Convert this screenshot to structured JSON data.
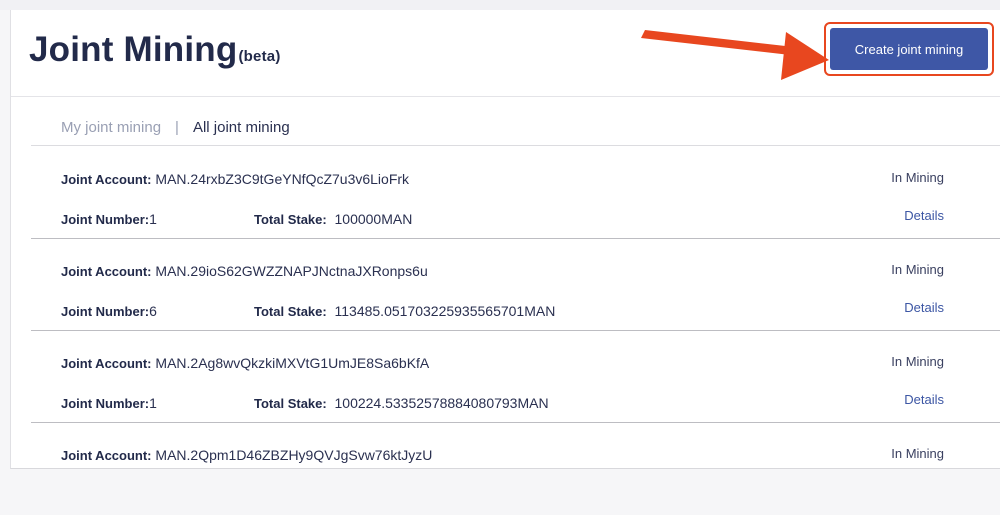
{
  "page": {
    "title": "Joint Mining",
    "title_suffix": "(beta)",
    "create_button": "Create joint mining"
  },
  "tabs": {
    "my": "My joint mining",
    "separator": "|",
    "all": "All joint mining"
  },
  "labels": {
    "joint_account": "Joint Account:",
    "joint_number": "Joint Number:",
    "total_stake": "Total Stake:",
    "details": "Details"
  },
  "rows": [
    {
      "account": "MAN.24rxbZ3C9tGeYNfQcZ7u3v6LioFrk",
      "status": "In Mining",
      "number": "1",
      "stake": "100000MAN"
    },
    {
      "account": "MAN.29ioS62GWZZNAPJNctnaJXRonps6u",
      "status": "In Mining",
      "number": "6",
      "stake": "113485.051703225935565701MAN"
    },
    {
      "account": "MAN.2Ag8wvQkzkiMXVtG1UmJE8Sa6bKfA",
      "status": "In Mining",
      "number": "1",
      "stake": "100224.53352578884080793MAN"
    },
    {
      "account": "MAN.2Qpm1D46ZBZHy9QVJgSvw76ktJyzU",
      "status": "In Mining"
    }
  ],
  "colors": {
    "primary": "#3e57a6",
    "highlight": "#e8471f",
    "link": "#3c56a4",
    "title": "#222a4a"
  }
}
